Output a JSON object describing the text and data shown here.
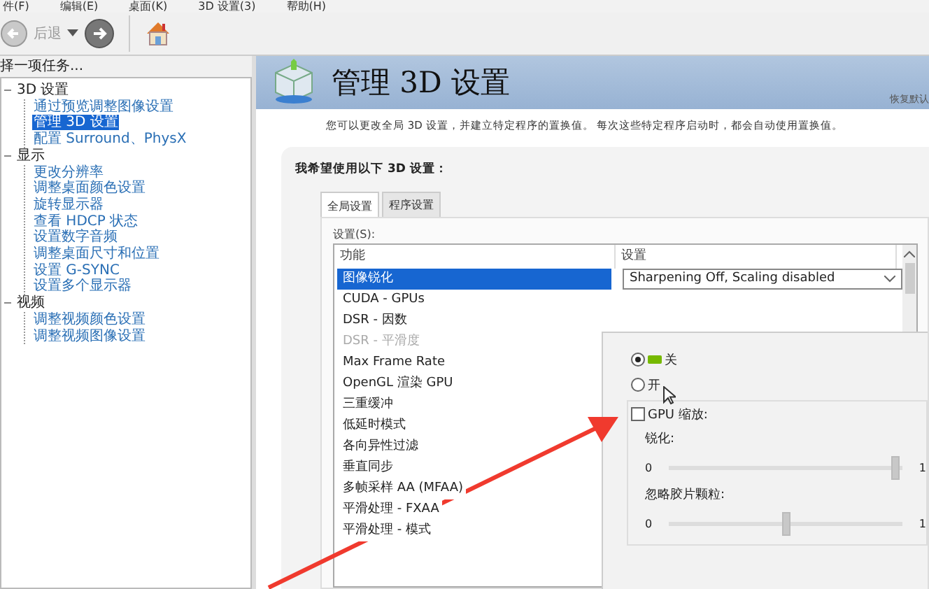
{
  "menu_bar": [
    "件(F)",
    "编辑(E)",
    "桌面(K)",
    "3D 设置(3)",
    "帮助(H)"
  ],
  "toolbar": {
    "back_label": "后退"
  },
  "sidebar": {
    "heading": "择一项任务...",
    "tree": [
      {
        "label": "3D 设置",
        "expanded": true,
        "selected": false,
        "children": [
          {
            "label": "通过预览调整图像设置",
            "selected": false
          },
          {
            "label": "管理 3D 设置",
            "selected": true
          },
          {
            "label": "配置 Surround、PhysX",
            "selected": false
          }
        ]
      },
      {
        "label": "显示",
        "expanded": true,
        "selected": false,
        "children": [
          {
            "label": "更改分辨率",
            "selected": false
          },
          {
            "label": "调整桌面颜色设置",
            "selected": false
          },
          {
            "label": "旋转显示器",
            "selected": false
          },
          {
            "label": "查看 HDCP 状态",
            "selected": false
          },
          {
            "label": "设置数字音频",
            "selected": false
          },
          {
            "label": "调整桌面尺寸和位置",
            "selected": false
          },
          {
            "label": "设置 G-SYNC",
            "selected": false
          },
          {
            "label": "设置多个显示器",
            "selected": false
          }
        ]
      },
      {
        "label": "视频",
        "expanded": true,
        "selected": false,
        "children": [
          {
            "label": "调整视频颜色设置",
            "selected": false
          },
          {
            "label": "调整视频图像设置",
            "selected": false
          }
        ]
      }
    ]
  },
  "page": {
    "title": "管理 3D 设置",
    "restore_link": "恢复默认",
    "description": "您可以更改全局 3D 设置，并建立特定程序的置换值。 每次这些特定程序启动时，都会自动使用置换值。",
    "panel_heading": "我希望使用以下 3D 设置：",
    "tabs": [
      {
        "label": "全局设置",
        "selected": true
      },
      {
        "label": "程序设置",
        "selected": false
      }
    ],
    "settings_label": "设置(S):",
    "table": {
      "columns": [
        "功能",
        "设置"
      ],
      "rows": [
        {
          "feature": "图像锐化",
          "value": "Sharpening Off, Scaling disabled",
          "selected": true,
          "disabled": false
        },
        {
          "feature": "CUDA - GPUs",
          "selected": false,
          "disabled": false
        },
        {
          "feature": "DSR - 因数",
          "selected": false,
          "disabled": false
        },
        {
          "feature": "DSR - 平滑度",
          "selected": false,
          "disabled": true
        },
        {
          "feature": "Max Frame Rate",
          "selected": false,
          "disabled": false
        },
        {
          "feature": "OpenGL 渲染 GPU",
          "selected": false,
          "disabled": false
        },
        {
          "feature": "三重缓冲",
          "selected": false,
          "disabled": false
        },
        {
          "feature": "低延时模式",
          "selected": false,
          "disabled": false
        },
        {
          "feature": "各向异性过滤",
          "selected": false,
          "disabled": false
        },
        {
          "feature": "垂直同步",
          "selected": false,
          "disabled": false
        },
        {
          "feature": "多帧采样 AA (MFAA)",
          "selected": false,
          "disabled": false
        },
        {
          "feature": "平滑处理 - FXAA",
          "selected": false,
          "disabled": false
        },
        {
          "feature": "平滑处理 - 模式",
          "selected": false,
          "disabled": false
        }
      ]
    },
    "popup": {
      "radios": [
        {
          "label": "关",
          "selected": true,
          "icon": true
        },
        {
          "label": "开",
          "selected": false,
          "icon": false
        }
      ],
      "checkbox": {
        "label": "GPU 缩放:",
        "checked": false
      },
      "sliders": [
        {
          "label": "锐化:",
          "min": "0",
          "max": "1",
          "level": 0.99
        },
        {
          "label": "忽略胶片颗粒:",
          "min": "0",
          "max": "1",
          "level": 0.5
        }
      ]
    }
  }
}
